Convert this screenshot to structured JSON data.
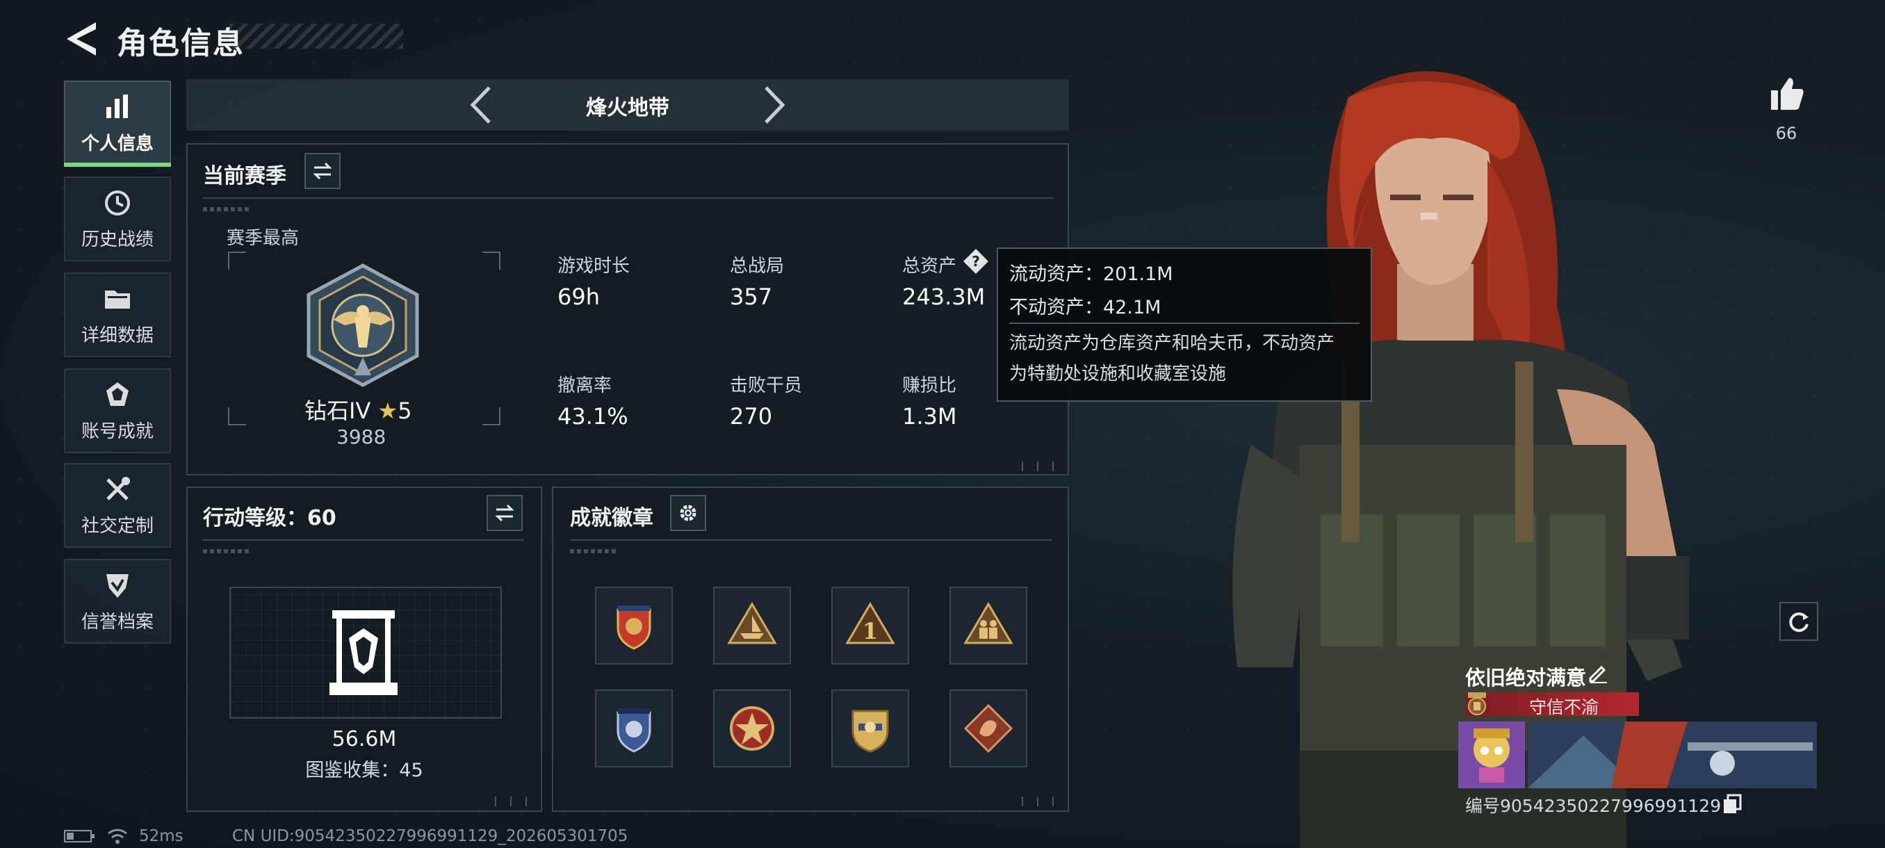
{
  "header": {
    "title": "角色信息"
  },
  "sidebar": {
    "items": [
      {
        "label": "个人信息",
        "icon": "bar-chart-icon",
        "active": true
      },
      {
        "label": "历史战绩",
        "icon": "clock-history-icon",
        "active": false
      },
      {
        "label": "详细数据",
        "icon": "folder-icon",
        "active": false
      },
      {
        "label": "账号成就",
        "icon": "achievement-icon",
        "active": false
      },
      {
        "label": "社交定制",
        "icon": "tools-icon",
        "active": false
      },
      {
        "label": "信誉档案",
        "icon": "shield-check-icon",
        "active": false
      }
    ]
  },
  "mode": {
    "title": "烽火地带"
  },
  "season": {
    "title": "当前赛季",
    "best_label": "赛季最高",
    "rank_name": "钻石IV",
    "rank_stars": "5",
    "rank_points": "3988",
    "stats": [
      {
        "label": "游戏时长",
        "value": "69h"
      },
      {
        "label": "总战局",
        "value": "357"
      },
      {
        "label": "总资产",
        "value": "243.3M"
      },
      {
        "label": "撤离率",
        "value": "43.1%"
      },
      {
        "label": "击败干员",
        "value": "270"
      },
      {
        "label": "赚损比",
        "value": "1.3M"
      }
    ]
  },
  "tooltip": {
    "liquid": "流动资产：201.1M",
    "fixed": "不动资产：42.1M",
    "desc_line1": "流动资产为仓库资产和哈夫币，不动资产",
    "desc_line2": "为特勤处设施和收藏室设施"
  },
  "action_level": {
    "title": "行动等级：60",
    "collection_value": "56.6M",
    "collection_count": "图鉴收集：45"
  },
  "achievements": {
    "title": "成就徽章",
    "badges": [
      {
        "icon": "shield-star-badge-icon",
        "color": "#c23a2a"
      },
      {
        "icon": "ship-triangle-badge-icon",
        "color": "#c9a055"
      },
      {
        "icon": "number-one-badge-icon",
        "color": "#c9a055"
      },
      {
        "icon": "soldiers-triangle-badge-icon",
        "color": "#c9a055"
      },
      {
        "icon": "blue-shield-badge-icon",
        "color": "#5a7ab8"
      },
      {
        "icon": "red-star-medal-badge-icon",
        "color": "#b33a2e"
      },
      {
        "icon": "gold-crest-badge-icon",
        "color": "#d8b25a"
      },
      {
        "icon": "dragon-diamond-badge-icon",
        "color": "#b25a3a"
      }
    ]
  },
  "profile": {
    "likes": "66",
    "player_name": "依旧绝对满意",
    "title_tag": "守信不渝",
    "uid_card": "编号905423502279969911​29"
  },
  "footer": {
    "ping": "52ms",
    "uid": "CN UID:90542350227996991129_202605301705"
  },
  "colors": {
    "accent_green": "#7fd68a",
    "tag_red": "#b32832",
    "gold": "#c9a055"
  }
}
